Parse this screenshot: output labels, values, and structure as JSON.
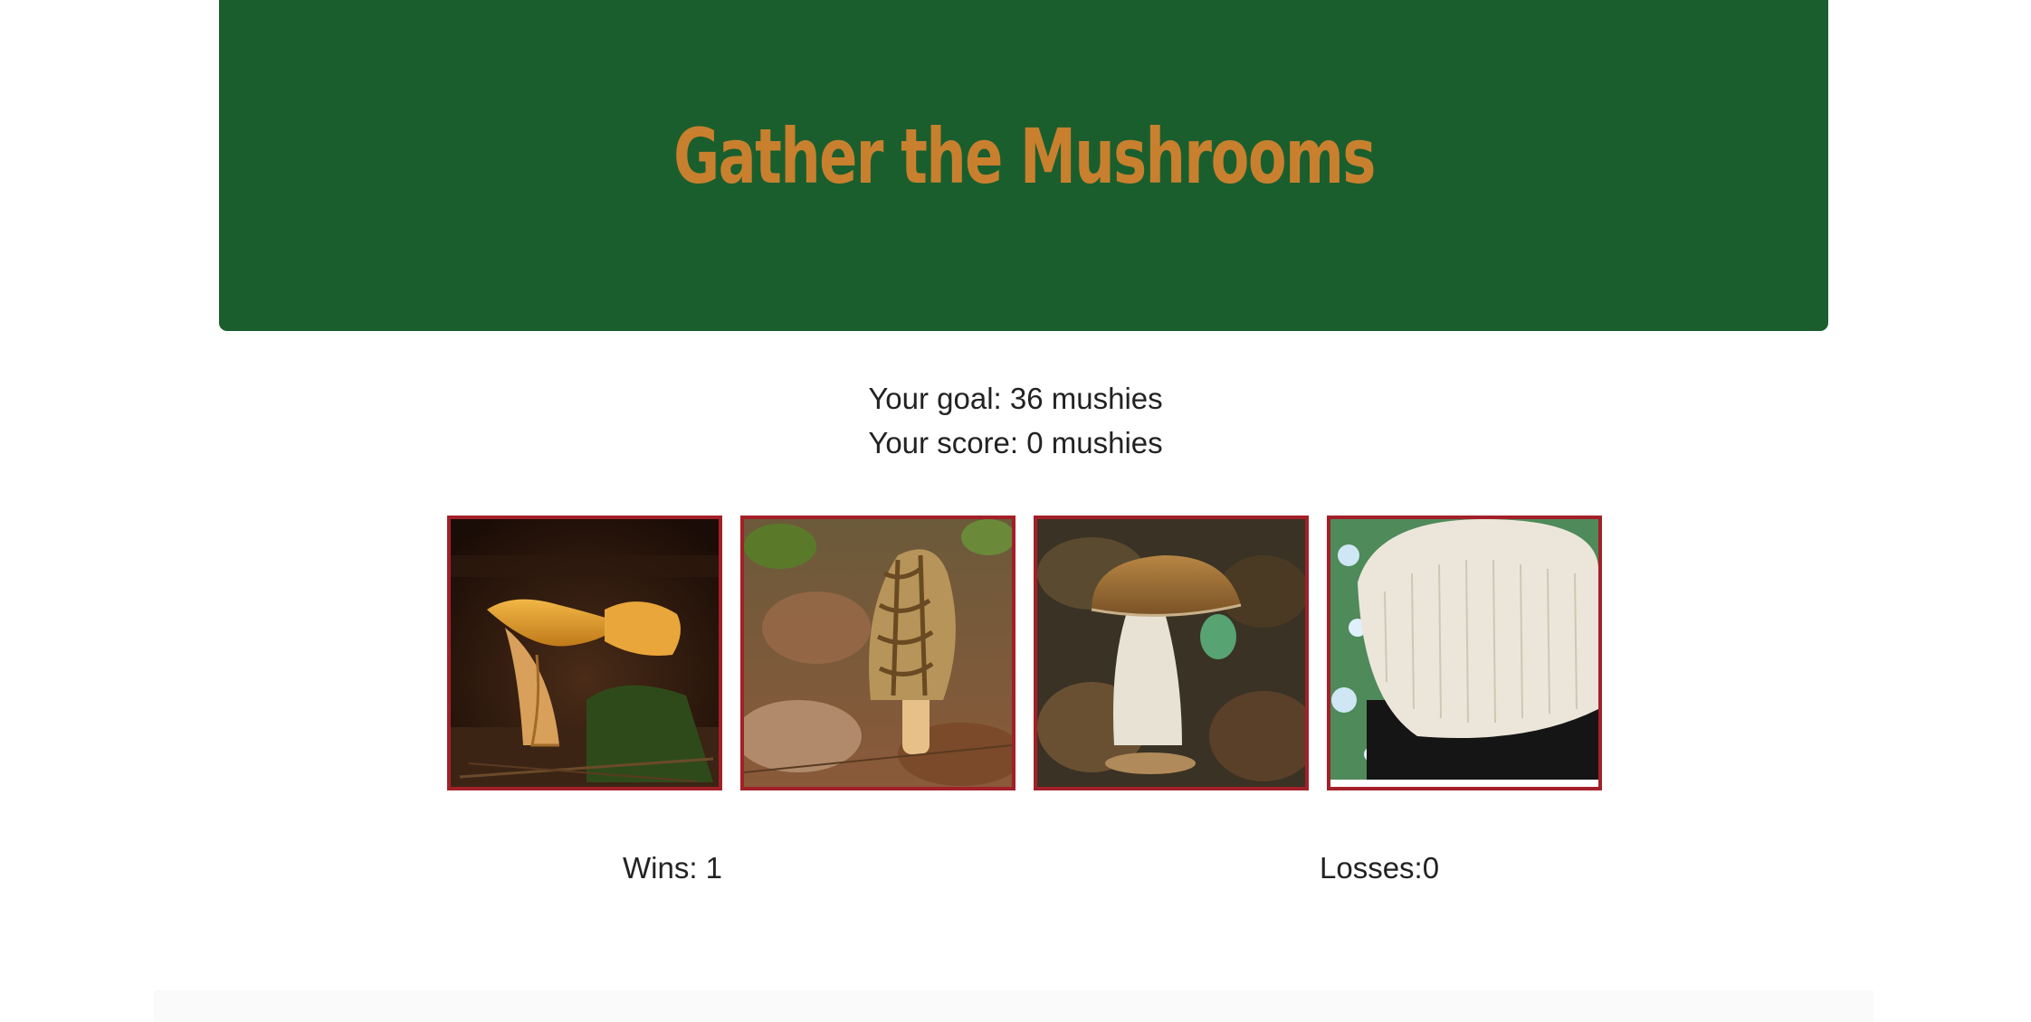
{
  "header": {
    "title": "Gather the Mushrooms",
    "background_color": "#1b5e2d",
    "title_color": "#c8802f"
  },
  "stats": {
    "goal_label": "Your goal: ",
    "goal_value": "36",
    "score_label": "Your score: ",
    "score_value": "0",
    "unit": " mushies"
  },
  "tiles": [
    {
      "name": "chanterelle"
    },
    {
      "name": "morel"
    },
    {
      "name": "porcini"
    },
    {
      "name": "lions-mane"
    }
  ],
  "tile_border_color": "#a32028",
  "record": {
    "wins_label": "Wins: ",
    "wins_value": "1",
    "losses_label": "Losses:",
    "losses_value": "0"
  }
}
